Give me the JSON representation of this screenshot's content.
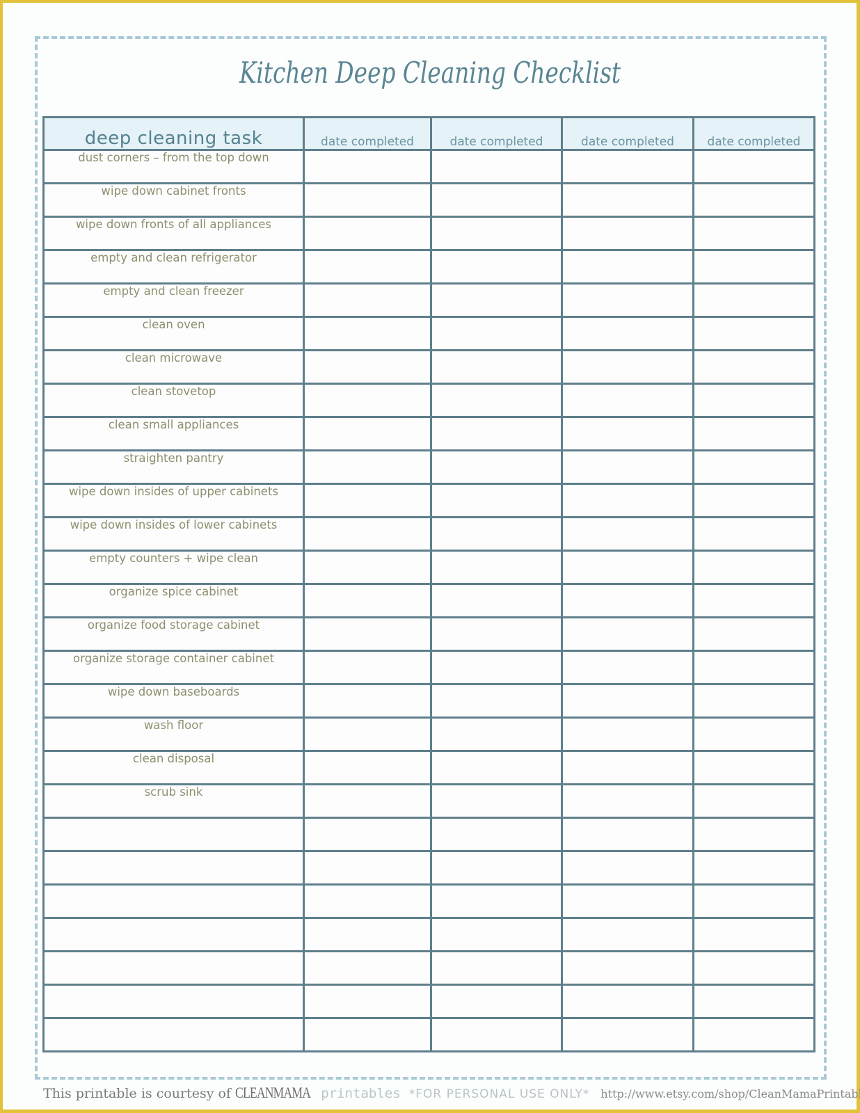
{
  "page": {
    "title": "Kitchen Deep Cleaning Checklist"
  },
  "table": {
    "headers": {
      "task": "deep cleaning task",
      "dates": [
        "date completed",
        "date completed",
        "date completed",
        "date completed"
      ]
    },
    "rows": [
      {
        "task": "dust corners – from the top down"
      },
      {
        "task": "wipe down cabinet fronts"
      },
      {
        "task": "wipe down fronts of all appliances"
      },
      {
        "task": "empty and clean refrigerator"
      },
      {
        "task": "empty and clean freezer"
      },
      {
        "task": "clean oven"
      },
      {
        "task": "clean microwave"
      },
      {
        "task": "clean stovetop"
      },
      {
        "task": "clean small appliances"
      },
      {
        "task": "straighten pantry"
      },
      {
        "task": "wipe down insides of upper cabinets"
      },
      {
        "task": "wipe down insides of lower cabinets"
      },
      {
        "task": "empty counters + wipe clean"
      },
      {
        "task": "organize spice cabinet"
      },
      {
        "task": "organize food storage cabinet"
      },
      {
        "task": "organize storage container cabinet"
      },
      {
        "task": "wipe down baseboards"
      },
      {
        "task": "wash floor"
      },
      {
        "task": "clean disposal"
      },
      {
        "task": "scrub sink"
      },
      {
        "task": ""
      },
      {
        "task": ""
      },
      {
        "task": ""
      },
      {
        "task": ""
      },
      {
        "task": ""
      },
      {
        "task": ""
      },
      {
        "task": ""
      }
    ]
  },
  "footer": {
    "courtesy": "This printable is courtesy of",
    "brand": "CLEANMAMA",
    "brand_suffix": "printables",
    "notice": "*FOR PERSONAL USE ONLY*",
    "url": "http://www.etsy.com/shop/CleanMamaPrintables"
  },
  "colors": {
    "page_border": "#e2c23a",
    "dashed_border": "#a9c9d6",
    "table_border": "#5f7f8c",
    "header_fill": "#e5f2f8",
    "title_text": "#5a8593",
    "task_text": "#8e8f6f"
  }
}
